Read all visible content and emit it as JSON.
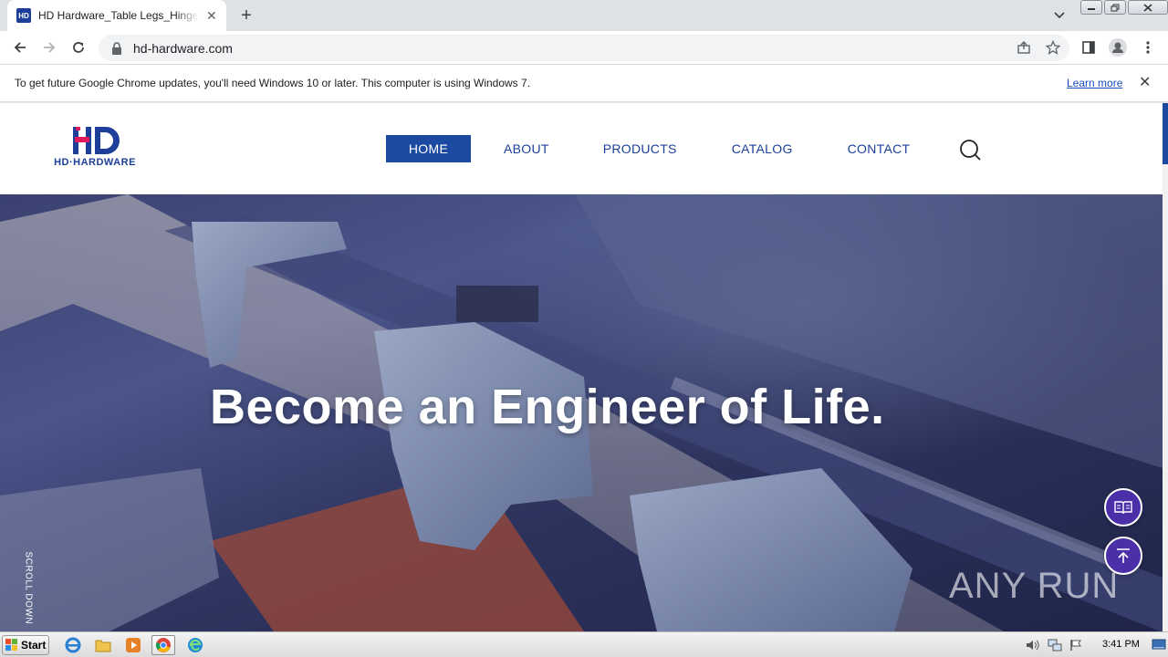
{
  "browser": {
    "tab_title": "HD Hardware_Table Legs_Hinge_Metal",
    "favicon_text": "HD",
    "url": "hd-hardware.com"
  },
  "infobar": {
    "message": "To get future Google Chrome updates, you'll need Windows 10 or later. This computer is using Windows 7.",
    "link_label": "Learn more"
  },
  "site": {
    "logo_wordmark": "HD·HARDWARE",
    "nav": [
      {
        "label": "HOME",
        "active": true
      },
      {
        "label": "ABOUT",
        "active": false
      },
      {
        "label": "PRODUCTS",
        "active": false
      },
      {
        "label": "CATALOG",
        "active": false
      },
      {
        "label": "CONTACT",
        "active": false
      }
    ],
    "hero_heading": "Become an Engineer of Life.",
    "scroll_label": "SCROLL DOWN",
    "brand_color": "#1d4aa1",
    "accent_color": "#e0195c",
    "float_button_color": "#4b2fa8"
  },
  "watermark": {
    "text": "ANY RUN"
  },
  "taskbar": {
    "start_label": "Start",
    "apps": [
      "internet-explorer-icon",
      "file-explorer-icon",
      "media-player-icon",
      "chrome-icon",
      "edge-icon"
    ],
    "clock": "3:41 PM"
  }
}
